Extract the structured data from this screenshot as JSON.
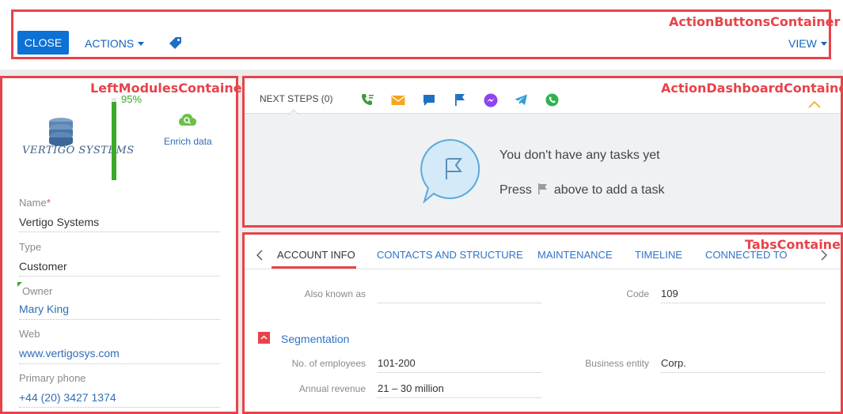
{
  "toolbar": {
    "close_label": "CLOSE",
    "actions_label": "ACTIONS",
    "view_label": "VIEW"
  },
  "regions": {
    "action_buttons": "ActionButtonsContainer",
    "left_modules": "LeftModulesContainer",
    "action_dashboard": "ActionDashboardContainer",
    "tabs": "TabsContainer"
  },
  "profile": {
    "logo_text": "VERTIGO SYSTEMS",
    "completeness": "95%",
    "completeness_value": 0.95,
    "enrich_label": "Enrich data"
  },
  "fields": {
    "name_label": "Name",
    "name_required": "*",
    "name_value": "Vertigo Systems",
    "type_label": "Type",
    "type_value": "Customer",
    "owner_label": "Owner",
    "owner_value": "Mary King",
    "web_label": "Web",
    "web_value": "www.vertigosys.com",
    "phone_label": "Primary phone",
    "phone_value": "+44 (20) 3427 1374"
  },
  "dashboard": {
    "next_steps_label": "NEXT STEPS (0)",
    "empty_title": "You don't have any tasks yet",
    "hint_before": "Press",
    "hint_after": "above to add a task",
    "icons": [
      "phone-icon",
      "email-icon",
      "chat-icon",
      "flag-icon",
      "messenger-icon",
      "telegram-icon",
      "whatsapp-icon"
    ],
    "colors": {
      "phone": "#3a9b3a",
      "email": "#f5a623",
      "chat": "#1f6fc5",
      "flag": "#1f6fc5",
      "messenger": "#8e44ef",
      "telegram": "#2f9fd8",
      "whatsapp": "#2fb24c"
    }
  },
  "tabs": {
    "items": [
      "ACCOUNT INFO",
      "CONTACTS AND STRUCTURE",
      "MAINTENANCE",
      "TIMELINE",
      "CONNECTED TO"
    ],
    "active": "ACCOUNT INFO"
  },
  "account_info": {
    "also_known_label": "Also known as",
    "also_known_value": "",
    "code_label": "Code",
    "code_value": "109",
    "segmentation_title": "Segmentation",
    "employees_label": "No. of employees",
    "employees_value": "101-200",
    "entity_label": "Business entity",
    "entity_value": "Corp.",
    "revenue_label": "Annual revenue",
    "revenue_value": "21 – 30 million"
  },
  "colors": {
    "accent": "#0d71d6",
    "highlight": "#e8434a",
    "progress": "#3aa829"
  }
}
